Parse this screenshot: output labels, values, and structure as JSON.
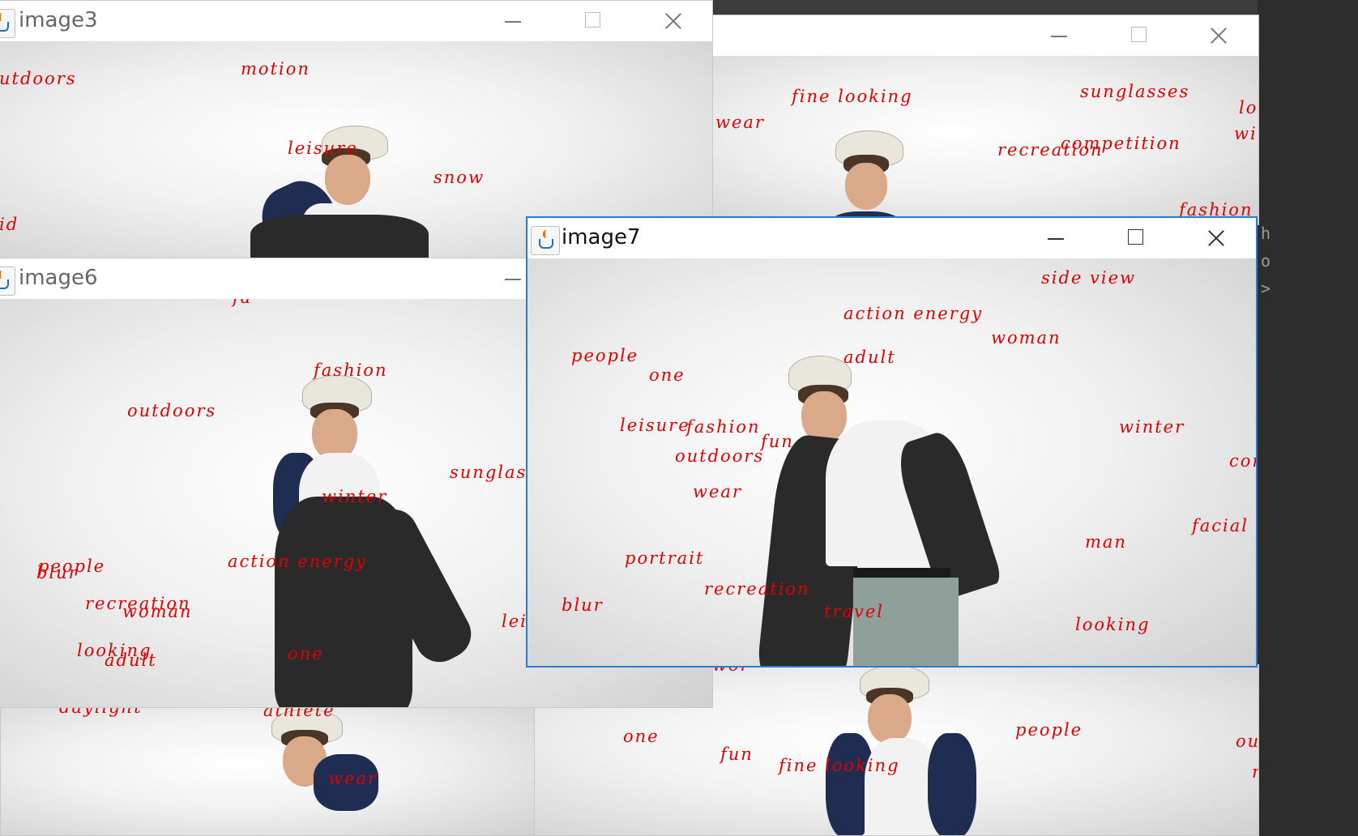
{
  "windows": {
    "back_right": {
      "title": "",
      "tags": [
        {
          "text": "fine looking"
        },
        {
          "text": "sunglasses"
        },
        {
          "text": "loo"
        },
        {
          "text": "wear"
        },
        {
          "text": "recreation"
        },
        {
          "text": "competition"
        },
        {
          "text": "wi"
        },
        {
          "text": "fashion"
        }
      ]
    },
    "back_bottom_left": {
      "title": "",
      "tags": [
        {
          "text": "daylight"
        },
        {
          "text": "athlete"
        },
        {
          "text": "wear"
        }
      ]
    },
    "back_bottom_right": {
      "title": "",
      "tags": [
        {
          "text": "one"
        },
        {
          "text": "fun"
        },
        {
          "text": "fine looking"
        },
        {
          "text": "people"
        },
        {
          "text": "out"
        },
        {
          "text": "m"
        },
        {
          "text": "wor"
        }
      ]
    },
    "image3": {
      "title": "image3",
      "tags": [
        {
          "text": "utdoors"
        },
        {
          "text": "motion"
        },
        {
          "text": "leisure"
        },
        {
          "text": "snow"
        },
        {
          "text": "id"
        }
      ]
    },
    "image6": {
      "title": "image6",
      "tags": [
        {
          "text": "fa"
        },
        {
          "text": "fashion"
        },
        {
          "text": "outdoors"
        },
        {
          "text": "sunglass"
        },
        {
          "text": "winter"
        },
        {
          "text": "people"
        },
        {
          "text": "blur"
        },
        {
          "text": "action energy"
        },
        {
          "text": "recreation"
        },
        {
          "text": "woman"
        },
        {
          "text": "lei"
        },
        {
          "text": "looking"
        },
        {
          "text": "adult"
        },
        {
          "text": "one"
        }
      ]
    },
    "image7": {
      "title": "image7",
      "tags": [
        {
          "text": "side view"
        },
        {
          "text": "action energy"
        },
        {
          "text": "woman"
        },
        {
          "text": "people"
        },
        {
          "text": "adult"
        },
        {
          "text": "one"
        },
        {
          "text": "leisure"
        },
        {
          "text": "fashion"
        },
        {
          "text": "fun"
        },
        {
          "text": "winter"
        },
        {
          "text": "outdoors"
        },
        {
          "text": "con"
        },
        {
          "text": "wear"
        },
        {
          "text": "facial"
        },
        {
          "text": "portrait"
        },
        {
          "text": "man"
        },
        {
          "text": "recreation"
        },
        {
          "text": "blur"
        },
        {
          "text": "travel"
        },
        {
          "text": "looking"
        }
      ]
    }
  },
  "editor_fragments": {
    "chars": [
      "h",
      "o",
      ">",
      "<"
    ]
  },
  "colors": {
    "tag_text": "#e00000",
    "active_border": "#2b7bd0",
    "desktop": "#2b2b2b"
  },
  "icons": {
    "window_icon": "java-icon",
    "minimize": "minimize-icon",
    "maximize": "maximize-icon",
    "close": "close-icon"
  }
}
